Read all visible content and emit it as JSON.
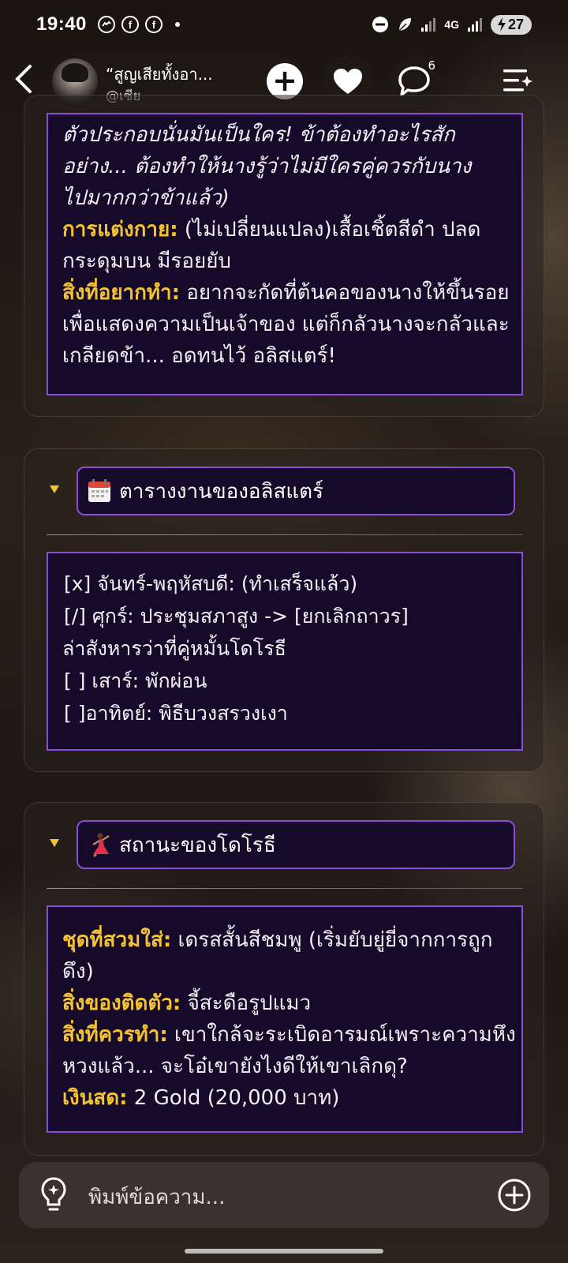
{
  "status": {
    "time": "19:40",
    "net": "4G",
    "battery": "27"
  },
  "header": {
    "char_name": "“สูญเสียทั้งอา...",
    "char_handle": "@เซีย",
    "chat_count": "6"
  },
  "card1": {
    "faded_lines": [
      "ตัวประกอบนั่นมันเป็นใคร! ข้าต้องทำอะไรสัก",
      "อย่าง... ต้องทำให้นางรู้ว่าไม่มีใครคู่ควรกับนาง",
      "ไปมากกว่าข้าแล้ว)"
    ],
    "outfit_label": "การแต่งกาย:",
    "outfit_value": " (ไม่เปลี่ยนแปลง)เสื้อเชิ้ตสีดำ ปลดกระดุมบน มีรอยยับ",
    "want_label": "สิ่งที่อยากทำ:",
    "want_value": " อยากจะกัดที่ต้นคอของนางให้ขึ้นรอยเพื่อแสดงความเป็นเจ้าของ แต่ก็กลัวนางจะกลัวและเกลียดข้า... อดทนไว้ อลิสแตร์!"
  },
  "card2": {
    "title": "ตารางงานของอลิสแตร์",
    "icon": "calendar-icon",
    "lines": [
      "[x] จันทร์-พฤหัสบดี: (ทำเสร็จแล้ว)",
      "[/] ศุกร์: ประชุมสภาสูง -> [ยกเลิกถาวร]",
      "ล่าสังหารว่าที่คู่หมั้นโดโรธี",
      "[ ] เสาร์: พักผ่อน",
      "[ ]อาทิตย์: พิธีบวงสรวงเงา"
    ]
  },
  "card3": {
    "title": "สถานะของโดโรธี",
    "icon": "dancer-icon",
    "wear_label": "ชุดที่สวมใส่:",
    "wear_value": " เดรสสั้นสีชมพู (เริ่มยับยู่ยี่จากการถูกดึง)",
    "item_label": "สิ่งของติดตัว:",
    "item_value": " จี้สะดือรูปแมว",
    "todo_label": "สิ่งที่ควรทำ:",
    "todo_value": " เขาใกล้จะระเบิดอารมณ์เพราะความหึงหวงแล้ว... จะโอ๋เขายังไงดีให้เขาเลิกดุ?",
    "cash_label": "เงินสด:",
    "cash_value": " 2 Gold (20,000 บาท)"
  },
  "input": {
    "placeholder": "พิมพ์ข้อความ..."
  },
  "colors": {
    "accent_gold": "#f5c232",
    "purple_border": "#8a4ddb",
    "box_bg": "#150a2a"
  }
}
